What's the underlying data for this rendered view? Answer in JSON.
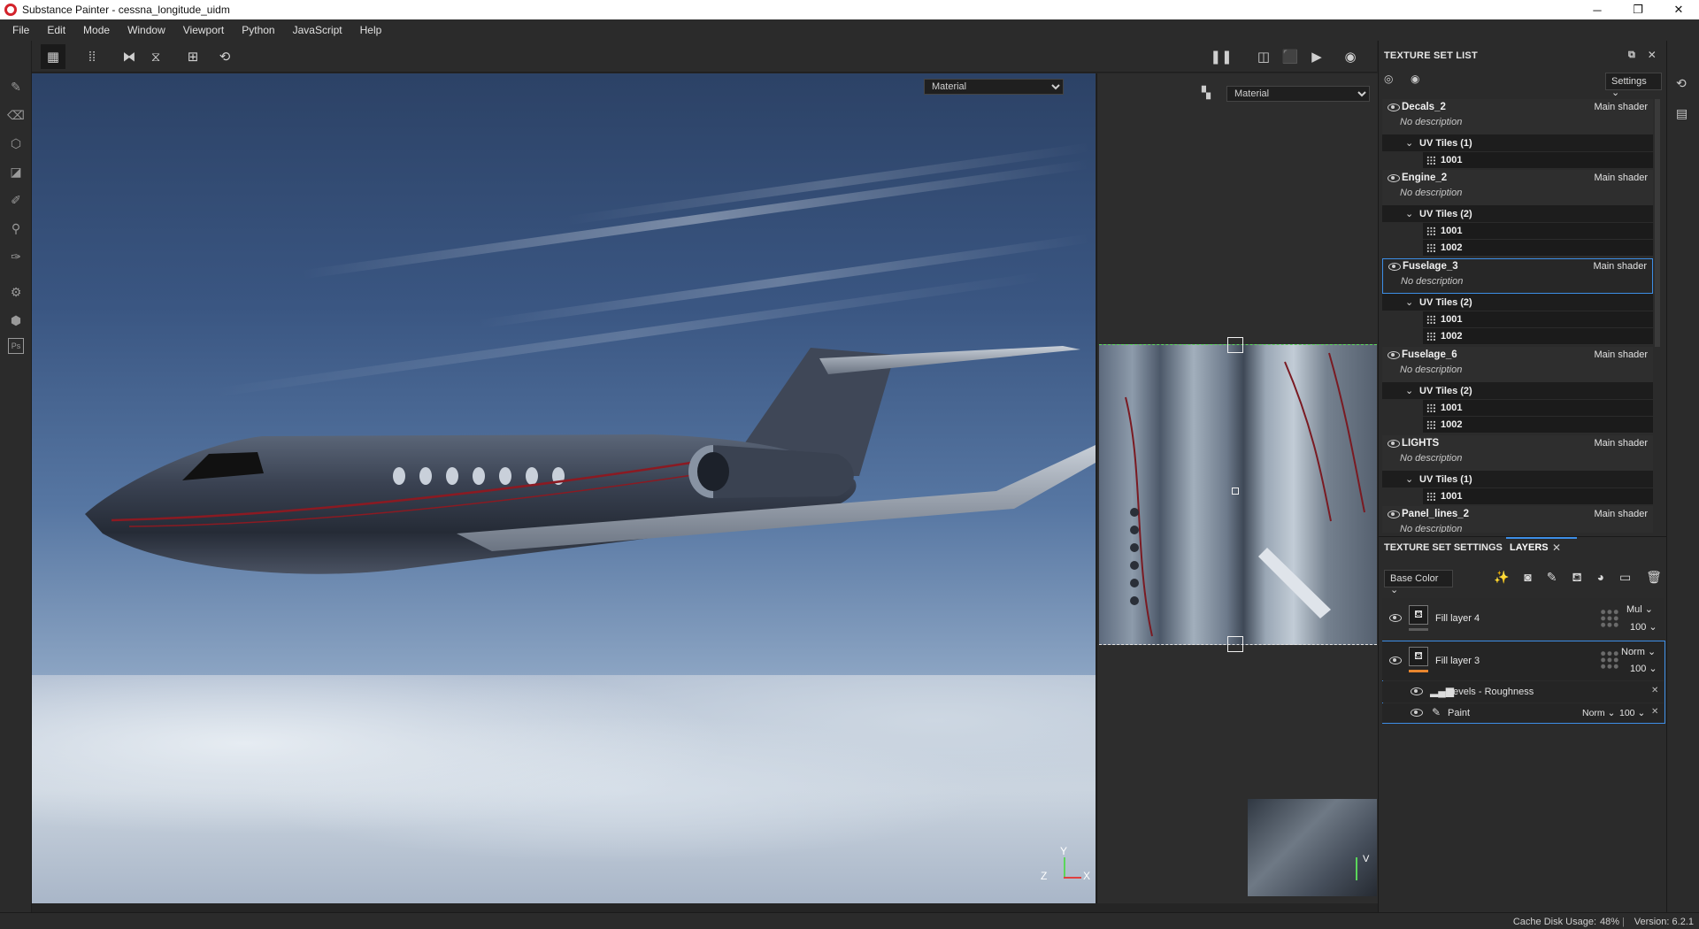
{
  "window": {
    "title": "Substance Painter - cessna_longitude_uidm",
    "minimize": "─",
    "maximize": "❐",
    "close": "✕"
  },
  "menu": [
    "File",
    "Edit",
    "Mode",
    "Window",
    "Viewport",
    "Python",
    "JavaScript",
    "Help"
  ],
  "viewport3d": {
    "channel_select": "Material",
    "gizmo": {
      "x": "X",
      "y": "Y",
      "z": "Z"
    }
  },
  "viewport2d": {
    "channel_select": "Material",
    "gizmo": {
      "v": "V"
    }
  },
  "texture_set_list": {
    "title": "TEXTURE SET LIST",
    "settings_label": "Settings",
    "sets": [
      {
        "name": "Decals_2",
        "shader": "Main shader",
        "description": "No description",
        "uv_label": "UV Tiles (1)",
        "tiles": [
          "1001"
        ]
      },
      {
        "name": "Engine_2",
        "shader": "Main shader",
        "description": "No description",
        "uv_label": "UV Tiles (2)",
        "tiles": [
          "1001",
          "1002"
        ]
      },
      {
        "name": "Fuselage_3",
        "shader": "Main shader",
        "description": "No description",
        "uv_label": "UV Tiles (2)",
        "tiles": [
          "1001",
          "1002"
        ]
      },
      {
        "name": "Fuselage_6",
        "shader": "Main shader",
        "description": "No description",
        "uv_label": "UV Tiles (2)",
        "tiles": [
          "1001",
          "1002"
        ]
      },
      {
        "name": "LIGHTS",
        "shader": "Main shader",
        "description": "No description",
        "uv_label": "UV Tiles (1)",
        "tiles": [
          "1001"
        ]
      },
      {
        "name": "Panel_lines_2",
        "shader": "Main shader",
        "description": "No description"
      }
    ]
  },
  "layers_panel": {
    "tab_settings": "TEXTURE SET SETTINGS",
    "tab_layers": "LAYERS",
    "channel": "Base Color",
    "layers": [
      {
        "name": "Fill layer 4",
        "blend": "Mul",
        "opacity": "100"
      },
      {
        "name": "Fill layer 3",
        "blend": "Norm",
        "opacity": "100",
        "effects": [
          {
            "name": "Levels - Roughness"
          },
          {
            "name": "Paint",
            "blend": "Norm",
            "opacity": "100"
          }
        ]
      }
    ]
  },
  "status": {
    "cache": "Cache Disk Usage:",
    "cache_value": "48%",
    "version": "Version: 6.2.1"
  },
  "colors": {
    "accent_blue": "#3d8ee6",
    "selection_orange": "#e8862e",
    "panel_bg": "#2b2b2b",
    "uv_guide_green": "#5bd65b"
  }
}
